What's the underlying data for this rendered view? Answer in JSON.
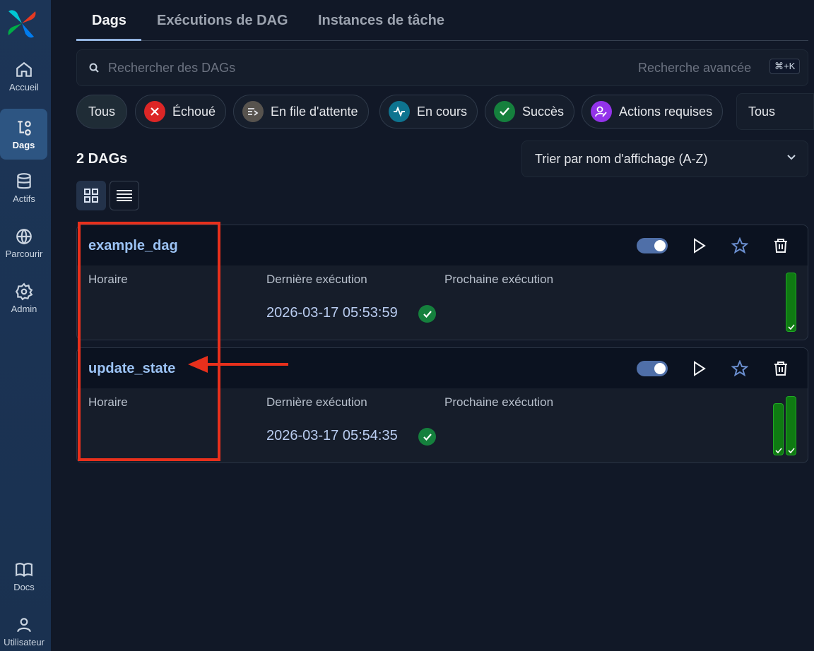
{
  "sidebar": {
    "items": [
      {
        "label": "Accueil",
        "icon": "home-icon"
      },
      {
        "label": "Dags",
        "icon": "dags-icon"
      },
      {
        "label": "Actifs",
        "icon": "database-icon"
      },
      {
        "label": "Parcourir",
        "icon": "globe-icon"
      },
      {
        "label": "Admin",
        "icon": "gear-icon"
      },
      {
        "label": "Docs",
        "icon": "book-icon"
      },
      {
        "label": "Utilisateur",
        "icon": "user-icon"
      }
    ]
  },
  "tabs": [
    "Dags",
    "Exécutions de DAG",
    "Instances de tâche"
  ],
  "search": {
    "placeholder": "Rechercher des DAGs",
    "advanced": "Recherche avancée",
    "shortcut": "⌘+K"
  },
  "filters": {
    "all": "Tous",
    "failed": "Échoué",
    "queued": "En file d'attente",
    "running": "En cours",
    "success": "Succès",
    "actions": "Actions requises",
    "select_value": "Tous"
  },
  "list": {
    "count": "2 DAGs",
    "sort": "Trier par nom d'affichage (A-Z)"
  },
  "dags": [
    {
      "id": "example_dag",
      "schedule_label": "Horaire",
      "last_run_label": "Dernière exécution",
      "next_run_label": "Prochaine exécution",
      "last_run": "2026-03-17 05:53:59",
      "enabled": true,
      "recent_runs": [
        "success"
      ]
    },
    {
      "id": "update_state",
      "schedule_label": "Horaire",
      "last_run_label": "Dernière exécution",
      "next_run_label": "Prochaine exécution",
      "last_run": "2026-03-17 05:54:35",
      "enabled": true,
      "recent_runs": [
        "success",
        "success"
      ]
    }
  ],
  "colors": {
    "accent": "#9cc3f5",
    "success": "#15803d",
    "failed": "#dc2626",
    "running": "#0891b2",
    "actions": "#9333ea",
    "annotation": "#e8301c"
  }
}
